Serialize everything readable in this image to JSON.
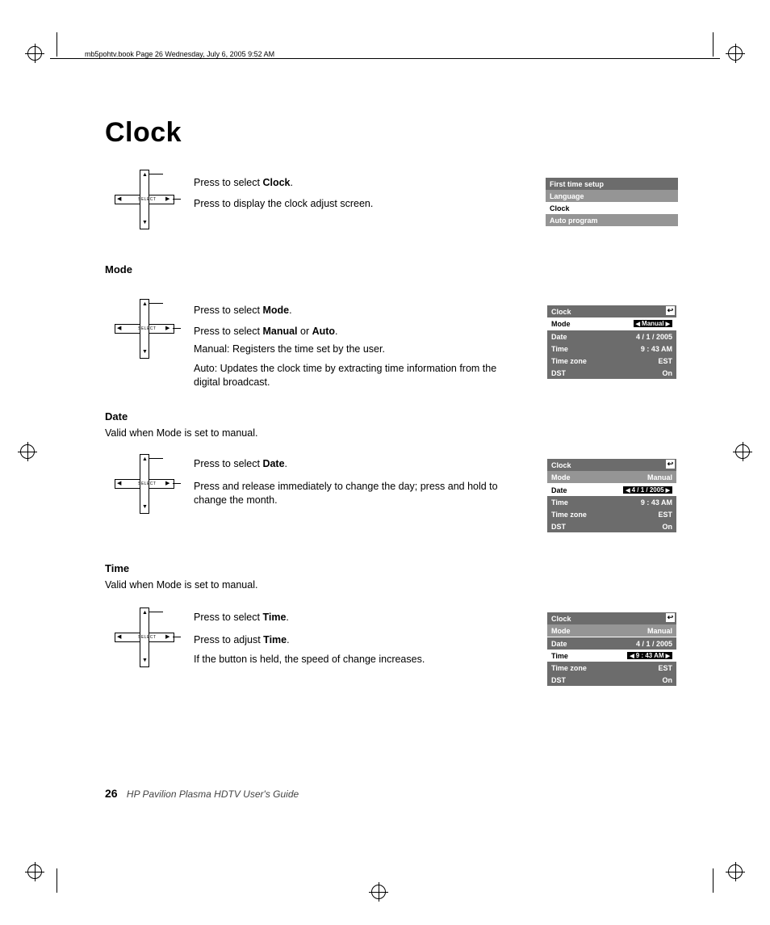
{
  "header": "mb5pohtv.book  Page 26  Wednesday, July 6, 2005  9:52 AM",
  "title": "Clock",
  "sections": {
    "clock": {
      "line1_pre": "Press to select ",
      "line1_bold": "Clock",
      "line1_post": ".",
      "line2": "Press to display the clock adjust screen."
    },
    "mode": {
      "heading": "Mode",
      "line1_pre": "Press to select ",
      "line1_bold": "Mode",
      "line1_post": ".",
      "line2_pre": "Press to select ",
      "line2_bold1": "Manual",
      "line2_mid": " or ",
      "line2_bold2": "Auto",
      "line2_post": ".",
      "line3": "Manual: Registers the time set by the user.",
      "line4": "Auto: Updates the clock time by extracting time information from the digital broadcast."
    },
    "date": {
      "heading": "Date",
      "subline": "Valid when Mode is set to manual.",
      "line1_pre": "Press to select ",
      "line1_bold": "Date",
      "line1_post": ".",
      "line2": "Press and release immediately to change the day; press and hold to change the month."
    },
    "time": {
      "heading": "Time",
      "subline": "Valid when Mode is set to manual.",
      "line1_pre": "Press to select ",
      "line1_bold": "Time",
      "line1_post": ".",
      "line2_pre": "Press to adjust ",
      "line2_bold": "Time",
      "line2_post": ".",
      "line3": "If the button is held, the speed of change increases."
    }
  },
  "setup_menu": {
    "items": [
      "First time setup",
      "Language",
      "Clock",
      "Auto program"
    ]
  },
  "osd_common": {
    "title": "Clock",
    "mode_label": "Mode",
    "mode_value": "Manual",
    "date_label": "Date",
    "date_value": "4 / 1 / 2005",
    "time_label": "Time",
    "time_value": "9 : 43 AM",
    "tz_label": "Time zone",
    "tz_value": "EST",
    "dst_label": "DST",
    "dst_value": "On"
  },
  "footer": {
    "page": "26",
    "text": "HP Pavilion Plasma HDTV User's Guide"
  },
  "dpad_label": "SELECT"
}
